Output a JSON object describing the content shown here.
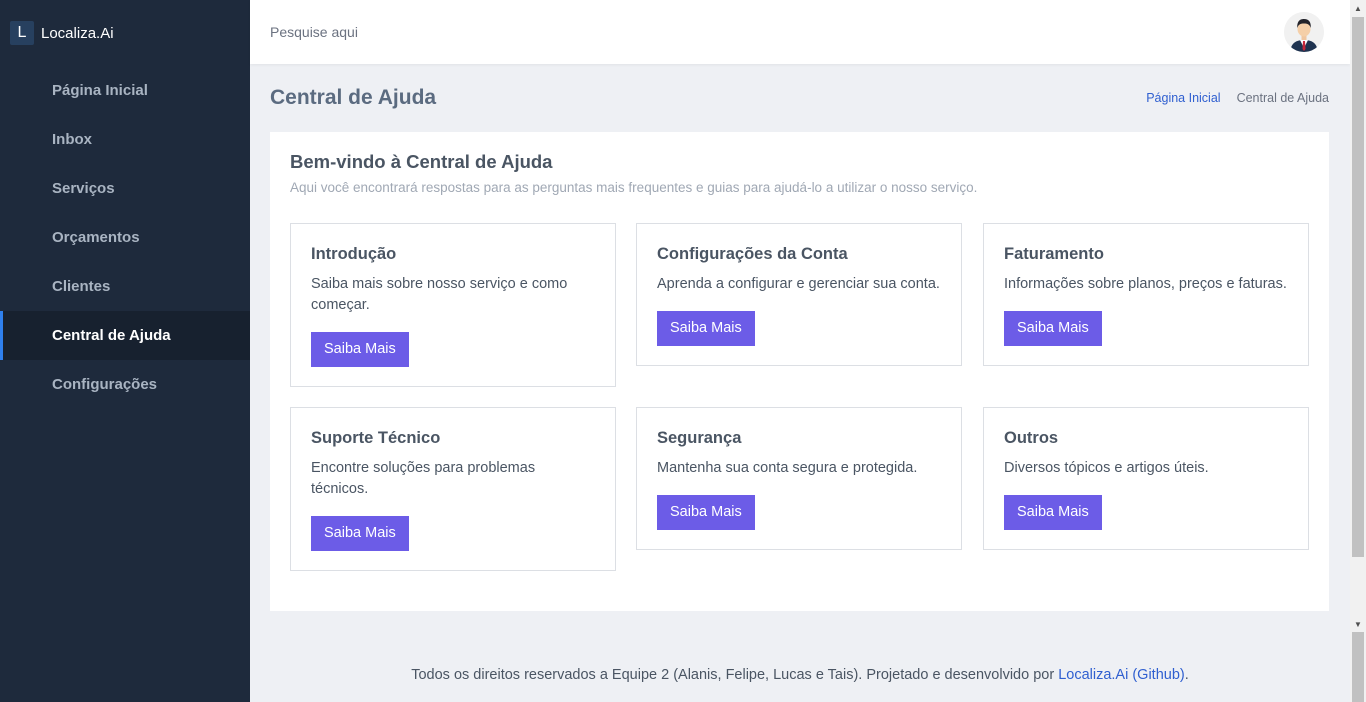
{
  "brand": {
    "logo_letter": "L",
    "name": "Localiza.Ai"
  },
  "sidebar": {
    "items": [
      {
        "label": "Página Inicial"
      },
      {
        "label": "Inbox"
      },
      {
        "label": "Serviços"
      },
      {
        "label": "Orçamentos"
      },
      {
        "label": "Clientes"
      },
      {
        "label": "Central de Ajuda",
        "active": true
      },
      {
        "label": "Configurações"
      }
    ]
  },
  "search": {
    "placeholder": "Pesquise aqui"
  },
  "page": {
    "title": "Central de Ajuda",
    "breadcrumb": {
      "home": "Página Inicial",
      "separator": "",
      "current": "Central de Ajuda"
    }
  },
  "help": {
    "welcome_title": "Bem-vindo à Central de Ajuda",
    "welcome_subtitle": "Aqui você encontrará respostas para as perguntas mais frequentes e guias para ajudá-lo a utilizar o nosso serviço.",
    "topics": [
      {
        "title": "Introdução",
        "description": "Saiba mais sobre nosso serviço e como começar.",
        "button": "Saiba Mais"
      },
      {
        "title": "Configurações da Conta",
        "description": "Aprenda a configurar e gerenciar sua conta.",
        "button": "Saiba Mais"
      },
      {
        "title": "Faturamento",
        "description": "Informações sobre planos, preços e faturas.",
        "button": "Saiba Mais"
      },
      {
        "title": "Suporte Técnico",
        "description": "Encontre soluções para problemas técnicos.",
        "button": "Saiba Mais"
      },
      {
        "title": "Segurança",
        "description": "Mantenha sua conta segura e protegida.",
        "button": "Saiba Mais"
      },
      {
        "title": "Outros",
        "description": "Diversos tópicos e artigos úteis.",
        "button": "Saiba Mais"
      }
    ]
  },
  "footer": {
    "text": "Todos os direitos reservados a Equipe 2 (Alanis, Felipe, Lucas e Tais). Projetado e desenvolvido por ",
    "link": "Localiza.Ai (Github)",
    "end": "."
  },
  "colors": {
    "sidebar_bg": "#1e2a3c",
    "accent_button": "#6c5ce7",
    "link": "#2f5fd0",
    "active_indicator": "#2f80ed"
  },
  "icons": {
    "avatar": "user-avatar-icon",
    "breadcrumb_separator": "chevron-right-icon"
  }
}
